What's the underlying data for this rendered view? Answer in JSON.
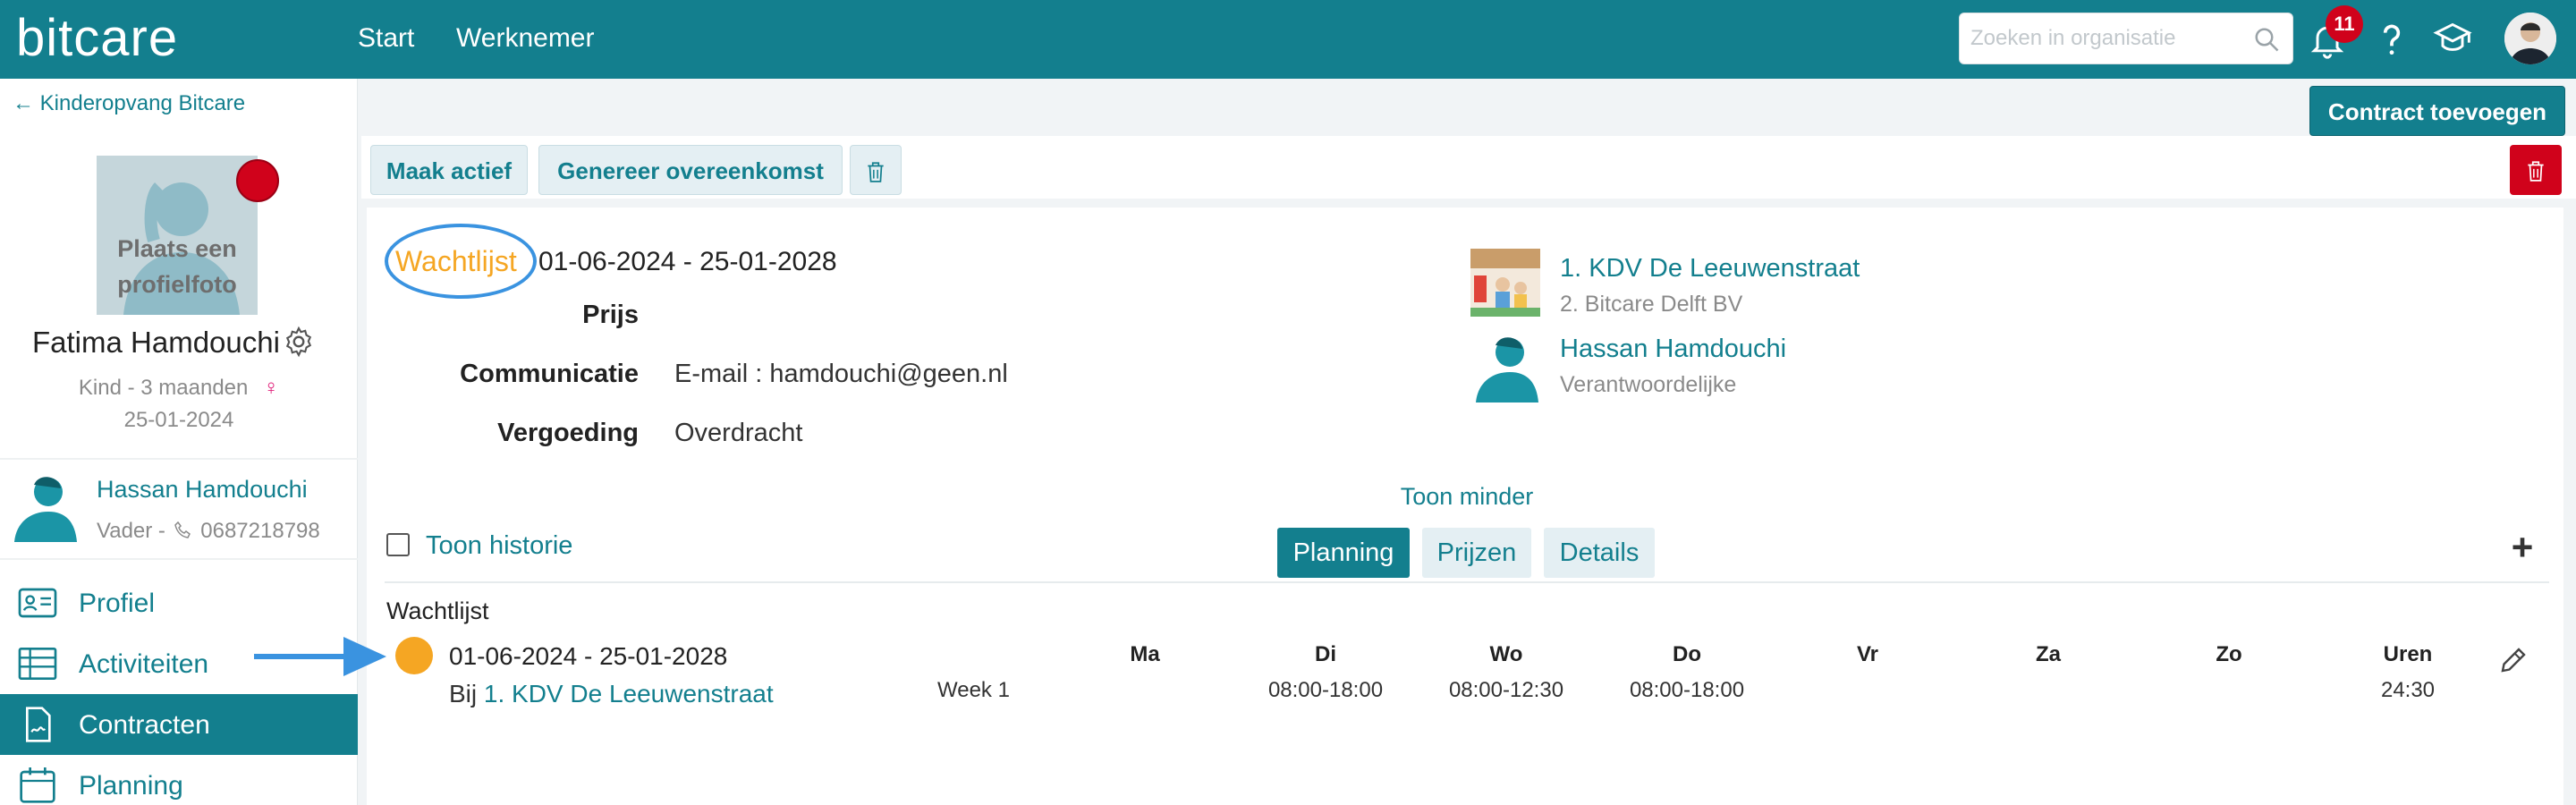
{
  "app": {
    "logo": "bitcare"
  },
  "nav": {
    "start": "Start",
    "werknemer": "Werknemer"
  },
  "search": {
    "placeholder": "Zoeken in organisatie"
  },
  "notifications": {
    "count": "11"
  },
  "sidebar": {
    "back_label": "Kinderopvang Bitcare",
    "photo_text_line1": "Plaats een",
    "photo_text_line2": "profielfoto",
    "child_name": "Fatima Hamdouchi",
    "child_meta": "Kind - 3 maanden",
    "gender_symbol": "♀",
    "child_date": "25-01-2024",
    "parent_name": "Hassan Hamdouchi",
    "parent_role": "Vader -",
    "parent_phone": "0687218798",
    "menu": [
      {
        "label": "Profiel"
      },
      {
        "label": "Activiteiten"
      },
      {
        "label": "Contracten"
      },
      {
        "label": "Planning"
      }
    ]
  },
  "toolbar": {
    "contract_add": "Contract toevoegen",
    "make_active": "Maak actief",
    "generate": "Genereer overeenkomst"
  },
  "contract": {
    "status": "Wachtlijst",
    "period": "01-06-2024 - 25-01-2028",
    "prijs_label": "Prijs",
    "communicatie_label": "Communicatie",
    "communicatie_value": "E-mail : hamdouchi@geen.nl",
    "vergoeding_label": "Vergoeding",
    "vergoeding_value": "Overdracht",
    "location_name": "1. KDV De Leeuwenstraat",
    "location_org": "2. Bitcare Delft BV",
    "responsible_name": "Hassan Hamdouchi",
    "responsible_role": "Verantwoordelijke",
    "toon_minder": "Toon minder",
    "toon_historie": "Toon historie",
    "tabs": [
      "Planning",
      "Prijzen",
      "Details"
    ]
  },
  "planning": {
    "section_title": "Wachtlijst",
    "row_period": "01-06-2024 - 25-01-2028",
    "row_bij": "Bij",
    "row_location": "1. KDV De Leeuwenstraat",
    "week": "Week 1",
    "days": [
      "Ma",
      "Di",
      "Wo",
      "Do",
      "Vr",
      "Za",
      "Zo",
      "Uren"
    ],
    "times": [
      "",
      "08:00-18:00",
      "08:00-12:30",
      "08:00-18:00",
      "",
      "",
      "",
      "24:30"
    ]
  },
  "colors": {
    "brand": "#137f8e",
    "wait_status": "#f5a623",
    "danger": "#d0021b",
    "highlight_ring": "#3a93e0"
  },
  "icons": [
    "bell-icon",
    "help-icon",
    "graduation-icon",
    "search-icon",
    "gear-icon",
    "trash-icon",
    "pencil-icon",
    "plus-icon",
    "phone-icon",
    "arrow-left-icon"
  ]
}
